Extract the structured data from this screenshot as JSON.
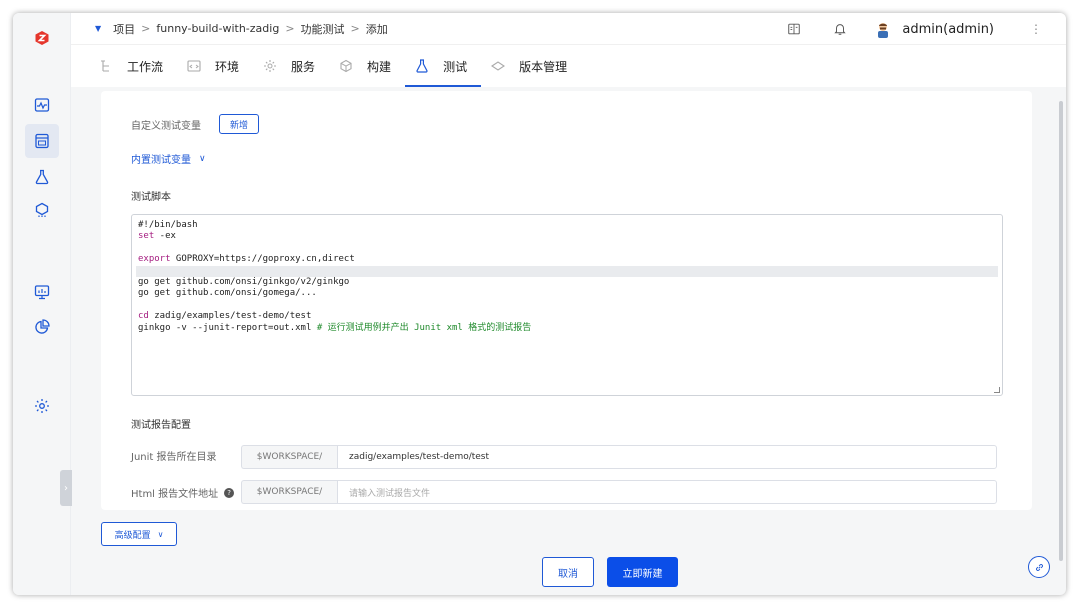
{
  "breadcrumb": {
    "items": [
      "项目",
      "funny-build-with-zadig",
      "功能测试",
      "添加"
    ],
    "separator": ">"
  },
  "header": {
    "user": "admin(admin)"
  },
  "tabs": [
    {
      "label": "工作流"
    },
    {
      "label": "环境"
    },
    {
      "label": "服务"
    },
    {
      "label": "构建"
    },
    {
      "label": "测试"
    },
    {
      "label": "版本管理"
    }
  ],
  "active_tab": "测试",
  "form": {
    "custom_vars_label": "自定义测试变量",
    "add_button": "新增",
    "builtin_vars_label": "内置测试变量",
    "script_section_title": "测试脚本",
    "script_lines": [
      "#!/bin/bash",
      "set -ex",
      "",
      "export GOPROXY=https://goproxy.cn,direct",
      "",
      "go get github.com/onsi/ginkgo/v2/ginkgo",
      "go get github.com/onsi/gomega/...",
      "",
      "cd zadig/examples/test-demo/test",
      "ginkgo -v --junit-report=out.xml # 运行测试用例并产出 Junit xml 格式的测试报告"
    ],
    "report_section_title": "测试报告配置",
    "junit_dir_label": "Junit 报告所在目录",
    "junit_prefix": "$WORKSPACE/",
    "junit_dir_value": "zadig/examples/test-demo/test",
    "html_path_label": "Html 报告文件地址",
    "html_prefix": "$WORKSPACE/",
    "html_path_placeholder": "请输入测试报告文件"
  },
  "bottom": {
    "advanced_config": "高级配置",
    "cancel": "取消",
    "create": "立即新建"
  },
  "colors": {
    "accent": "#1f59d6",
    "primary_button": "#0b4ee8",
    "logo": "#e5362c"
  }
}
